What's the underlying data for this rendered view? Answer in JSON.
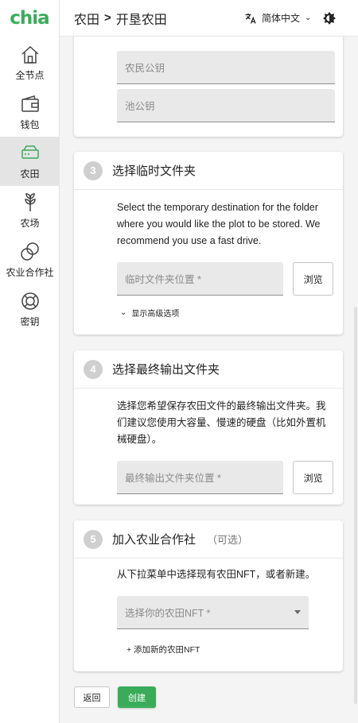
{
  "app": {
    "logo": "chia"
  },
  "sidebar": {
    "items": [
      {
        "label": "全节点",
        "icon": "home-icon"
      },
      {
        "label": "钱包",
        "icon": "wallet-icon"
      },
      {
        "label": "农田",
        "icon": "farm-drive-icon",
        "active": true
      },
      {
        "label": "农场",
        "icon": "plant-icon"
      },
      {
        "label": "农业合作社",
        "icon": "pool-rings-icon"
      },
      {
        "label": "密钥",
        "icon": "keys-lifebuoy-icon"
      }
    ]
  },
  "header": {
    "breadcrumb_parent": "农田",
    "breadcrumb_separator": ">",
    "breadcrumb_current": "开垦农田",
    "language": "简体中文",
    "theme_icon": "theme-toggle-icon"
  },
  "keys_card": {
    "farmer_key_placeholder": "农民公钥",
    "pool_key_placeholder": "池公钥"
  },
  "step3": {
    "number": "3",
    "title": "选择临时文件夹",
    "description": "Select the temporary destination for the folder where you would like the plot to be stored. We recommend you use a fast drive.",
    "field_placeholder": "临时文件夹位置 *",
    "browse_label": "浏览",
    "advanced_label": "显示高级选项"
  },
  "step4": {
    "number": "4",
    "title": "选择最终输出文件夹",
    "description": "选择您希望保存农田文件的最终输出文件夹。我们建议您使用大容量、慢速的硬盘（比如外置机械硬盘）。",
    "field_placeholder": "最终输出文件夹位置 *",
    "browse_label": "浏览"
  },
  "step5": {
    "number": "5",
    "title": "加入农业合作社",
    "optional_label": "（可选）",
    "description": "从下拉菜单中选择现有农田NFT，或者新建。",
    "select_placeholder": "选择你的农田NFT *",
    "add_nft_label": "+ 添加新的农田NFT"
  },
  "actions": {
    "back_label": "返回",
    "create_label": "创建"
  },
  "colors": {
    "accent": "#3aac59",
    "step_badge": "#cfcfcf"
  }
}
